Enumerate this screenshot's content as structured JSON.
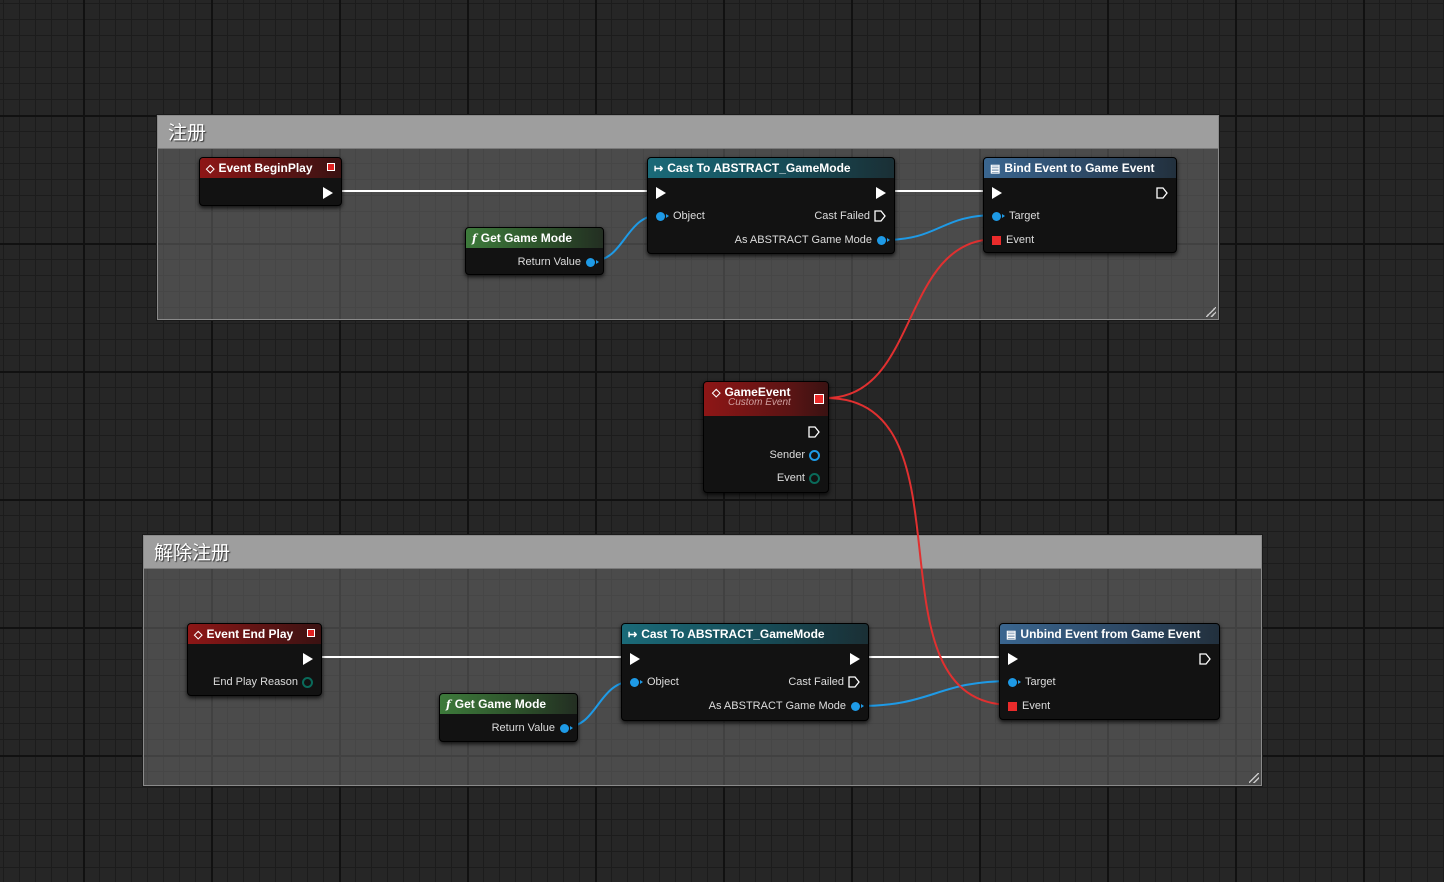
{
  "comments": [
    {
      "title": "注册"
    },
    {
      "title": "解除注册"
    }
  ],
  "nodes": {
    "begin_play": {
      "title": "Event BeginPlay"
    },
    "get_gm_1": {
      "title": "Get Game Mode",
      "return_label": "Return Value"
    },
    "cast_1": {
      "title": "Cast To ABSTRACT_GameMode",
      "object_label": "Object",
      "cast_failed_label": "Cast Failed",
      "as_label": "As ABSTRACT Game Mode"
    },
    "bind": {
      "title": "Bind Event to Game Event",
      "target_label": "Target",
      "event_label": "Event"
    },
    "game_event": {
      "title": "GameEvent",
      "subtitle": "Custom Event",
      "sender_label": "Sender",
      "event_label": "Event"
    },
    "end_play": {
      "title": "Event End Play",
      "reason_label": "End Play Reason"
    },
    "get_gm_2": {
      "title": "Get Game Mode",
      "return_label": "Return Value"
    },
    "cast_2": {
      "title": "Cast To ABSTRACT_GameMode",
      "object_label": "Object",
      "cast_failed_label": "Cast Failed",
      "as_label": "As ABSTRACT Game Mode"
    },
    "unbind": {
      "title": "Unbind Event from Game Event",
      "target_label": "Target",
      "event_label": "Event"
    }
  },
  "colors": {
    "exec_wire": "#ffffff",
    "object_wire": "#1e9ae6",
    "delegate_wire": "#e03030",
    "event_header": "#8e1616",
    "cast_header": "#1a6a78",
    "function_header": "#3d7a3b",
    "call_header": "#3a6690"
  },
  "icons": {
    "event": "event-diamond-icon",
    "cast": "cast-arrow-icon",
    "function": "function-f-icon",
    "call": "call-function-icon"
  }
}
